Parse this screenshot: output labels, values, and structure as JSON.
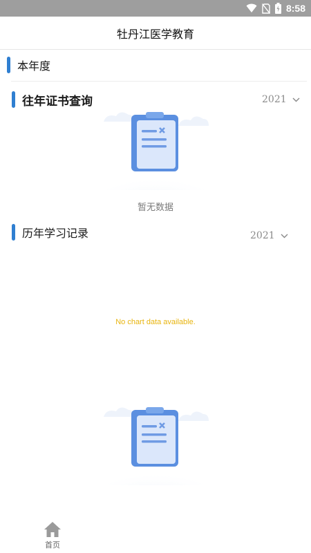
{
  "status_bar": {
    "time": "8:58",
    "icons": [
      "wifi-icon",
      "no-sim-icon",
      "battery-icon"
    ]
  },
  "header": {
    "title": "牡丹江医学教育"
  },
  "sections": {
    "current_year": {
      "title": "本年度"
    },
    "certificates": {
      "title": "往年证书查询",
      "year": "2021",
      "empty_text": "暂无数据"
    },
    "study_records": {
      "title": "历年学习记录",
      "year": "2021",
      "chart_message": "No chart data available."
    }
  },
  "tab_bar": {
    "items": [
      {
        "label": "首页",
        "icon": "home-icon"
      }
    ]
  },
  "colors": {
    "accent": "#2f7fd1",
    "chart_message": "#e8b40e",
    "status_bar": "#9e9e9e"
  }
}
